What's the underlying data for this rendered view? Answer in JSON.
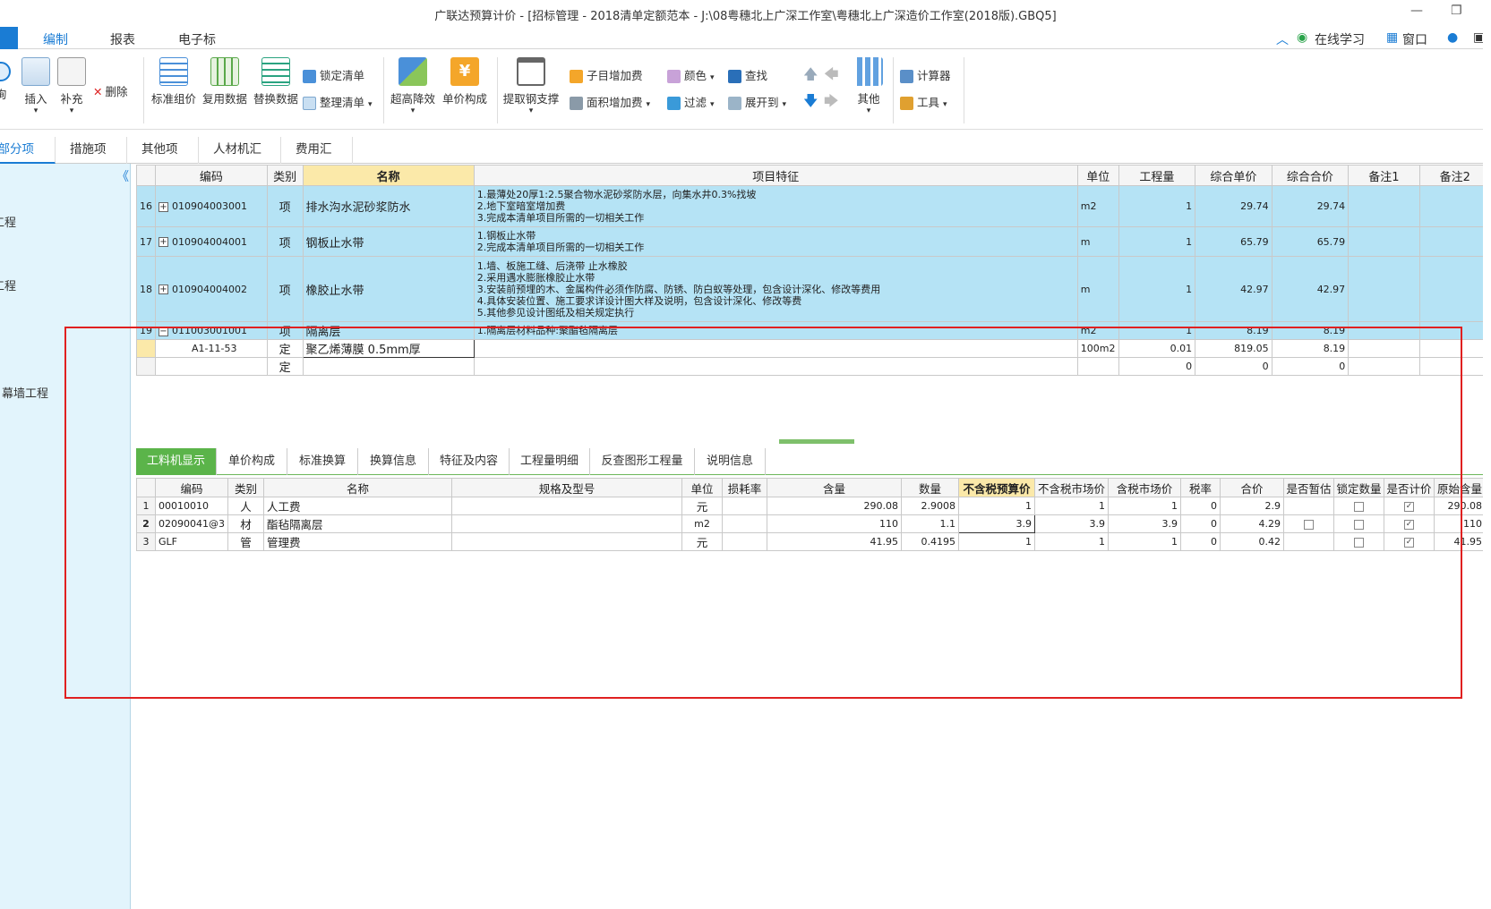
{
  "window": {
    "title": "广联达预算计价 - [招标管理 - 2018清单定额范本 - J:\\08粤穗北上广深工作室\\粤穗北上广深造价工作室(2018版).GBQ5]"
  },
  "menu": {
    "items": [
      "编制",
      "报表",
      "电子标"
    ],
    "right_items": [
      "在线学习",
      "窗口"
    ]
  },
  "ribbon": {
    "left_partial": [
      "询",
      "插入",
      "补充"
    ],
    "delete": "删除",
    "big_buttons": [
      "标准组价",
      "复用数据",
      "替换数据"
    ],
    "lock_list": "锁定清单",
    "organize_list": "整理清单",
    "big_buttons2": [
      "超高降效",
      "单价构成"
    ],
    "extract_rebar": "提取钢支撑",
    "sub_add_fee": "子目增加费",
    "area_add_fee": "面积增加费",
    "color": "颜色",
    "find": "查找",
    "filter": "过滤",
    "expand_to": "展开到",
    "other": "其他",
    "calculator": "计算器",
    "tools": "工具"
  },
  "tabs": [
    "分部分项",
    "措施项目",
    "其他项目",
    "人材机汇总",
    "费用汇总"
  ],
  "sidebar": {
    "items": [
      "工程",
      "工程",
      "幕墙工程",
      "程"
    ]
  },
  "main_table": {
    "headers": [
      "编码",
      "类别",
      "名称",
      "项目特征",
      "单位",
      "工程量",
      "综合单价",
      "综合合价",
      "备注1",
      "备注2"
    ],
    "rows": [
      {
        "no": "16",
        "code": "010904003001",
        "type": "项",
        "name": "排水沟水泥砂浆防水",
        "features": [
          "1.最薄处20厚1:2.5聚合物水泥砂浆防水层，向集水井0.3%找坡",
          "2.地下室暗室增加费",
          "3.完成本清单项目所需的一切相关工作"
        ],
        "unit": "m2",
        "qty": "1",
        "price": "29.74",
        "total": "29.74"
      },
      {
        "no": "17",
        "code": "010904004001",
        "type": "项",
        "name": "钢板止水带",
        "features": [
          "1.钢板止水带",
          "2.完成本清单项目所需的一切相关工作"
        ],
        "unit": "m",
        "qty": "1",
        "price": "65.79",
        "total": "65.79"
      },
      {
        "no": "18",
        "code": "010904004002",
        "type": "项",
        "name": "橡胶止水带",
        "features": [
          "1.墙、板施工缝、后浇带 止水橡胶",
          "2.采用遇水膨胀橡胶止水带",
          "3.安装前预埋的木、金属构件必须作防腐、防锈、防白蚁等处理，包含设计深化、修改等费用",
          "4.具体安装位置、施工要求详设计图大样及说明，包含设计深化、修改等费",
          "5.其他参见设计图纸及相关规定执行"
        ],
        "unit": "m",
        "qty": "1",
        "price": "42.97",
        "total": "42.97"
      },
      {
        "no": "19",
        "code": "011003001001",
        "type": "项",
        "name": "隔离层",
        "features": [
          "1.隔离层材料品种:聚酯毡隔离层"
        ],
        "unit": "m2",
        "qty": "1",
        "price": "8.19",
        "total": "8.19"
      },
      {
        "no": "",
        "code": "A1-11-53",
        "type": "定",
        "name": "聚乙烯薄膜 0.5mm厚",
        "features": [
          ""
        ],
        "unit": "100m2",
        "qty": "0.01",
        "price": "819.05",
        "total": "8.19"
      },
      {
        "no": "",
        "code": "",
        "type": "定",
        "name": "",
        "features": [
          ""
        ],
        "unit": "",
        "qty": "0",
        "price": "0",
        "total": "0"
      }
    ]
  },
  "bottom_tabs": [
    "工料机显示",
    "单价构成",
    "标准换算",
    "换算信息",
    "特征及内容",
    "工程量明细",
    "反查图形工程量",
    "说明信息"
  ],
  "sub_table": {
    "headers": [
      "编码",
      "类别",
      "名称",
      "规格及型号",
      "单位",
      "损耗率",
      "含量",
      "数量",
      "不含税预算价",
      "不含税市场价",
      "含税市场价",
      "税率",
      "合价",
      "是否暂估",
      "锁定数量",
      "是否计价",
      "原始含量"
    ],
    "rows": [
      {
        "no": "1",
        "code": "00010010",
        "type": "人",
        "name": "人工费",
        "unit": "元",
        "content": "290.08",
        "qty": "2.9008",
        "pre_tax_budget": "1",
        "pre_tax_market": "1",
        "tax_market": "1",
        "rate": "0",
        "total": "2.9",
        "orig": "290.08"
      },
      {
        "no": "2",
        "code": "02090041@3",
        "type": "材",
        "name": "酯毡隔离层",
        "unit": "m2",
        "content": "110",
        "qty": "1.1",
        "pre_tax_budget": "3.9",
        "pre_tax_market": "3.9",
        "tax_market": "3.9",
        "rate": "0",
        "total": "4.29",
        "orig": "110"
      },
      {
        "no": "3",
        "code": "GLF",
        "type": "管",
        "name": "管理费",
        "unit": "元",
        "content": "41.95",
        "qty": "0.4195",
        "pre_tax_budget": "1",
        "pre_tax_market": "1",
        "tax_market": "1",
        "rate": "0",
        "total": "0.42",
        "orig": "41.95"
      }
    ]
  }
}
